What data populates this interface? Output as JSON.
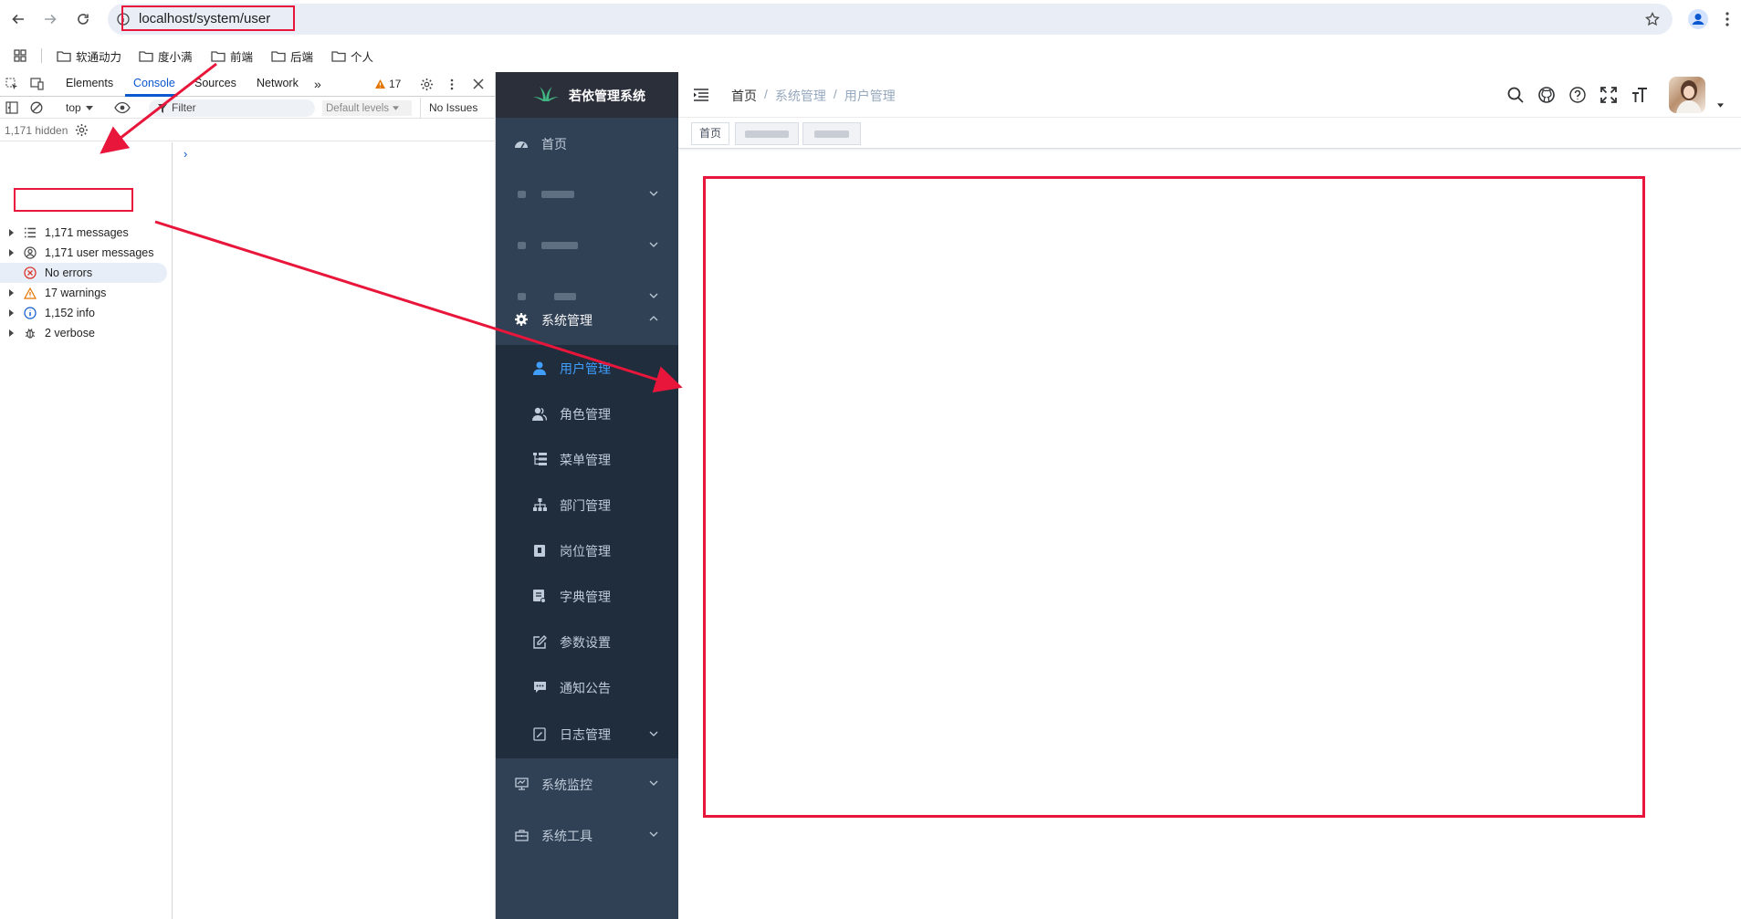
{
  "browser": {
    "url": "localhost/system/user",
    "bookmarks": [
      "软通动力",
      "度小满",
      "前端",
      "后端",
      "个人"
    ]
  },
  "devtools": {
    "tabs": [
      "Elements",
      "Console",
      "Sources",
      "Network"
    ],
    "active_tab": "Console",
    "warning_count": "17",
    "context": "top",
    "filter_placeholder": "Filter",
    "levels": "Default levels",
    "issues": "No Issues",
    "hidden": "1,171 hidden",
    "prompt": "›",
    "sidebar": [
      {
        "label": "1,171 messages",
        "icon": "list-icon"
      },
      {
        "label": "1,171 user messages",
        "icon": "user-circle-icon"
      },
      {
        "label": "No errors",
        "icon": "error-icon"
      },
      {
        "label": "17 warnings",
        "icon": "warning-icon"
      },
      {
        "label": "1,152 info",
        "icon": "info-icon"
      },
      {
        "label": "2 verbose",
        "icon": "bug-icon"
      }
    ]
  },
  "app": {
    "title": "若依管理系统",
    "menu": {
      "home": "首页",
      "system": "系统管理",
      "monitor": "系统监控",
      "tools": "系统工具"
    },
    "submenu": [
      {
        "label": "用户管理",
        "icon": "user-icon",
        "active": true
      },
      {
        "label": "角色管理",
        "icon": "peoples-icon"
      },
      {
        "label": "菜单管理",
        "icon": "tree-table-icon"
      },
      {
        "label": "部门管理",
        "icon": "tree-icon"
      },
      {
        "label": "岗位管理",
        "icon": "post-icon"
      },
      {
        "label": "字典管理",
        "icon": "dict-icon"
      },
      {
        "label": "参数设置",
        "icon": "edit-icon"
      },
      {
        "label": "通知公告",
        "icon": "message-icon"
      },
      {
        "label": "日志管理",
        "icon": "log-icon"
      }
    ],
    "breadcrumb": [
      "首页",
      "系统管理",
      "用户管理"
    ],
    "tags": [
      "首页"
    ]
  },
  "colors": {
    "annotation": "#e8163a",
    "sidebar_bg": "#304156",
    "submenu_bg": "#1f2d3d",
    "active": "#409eff"
  }
}
